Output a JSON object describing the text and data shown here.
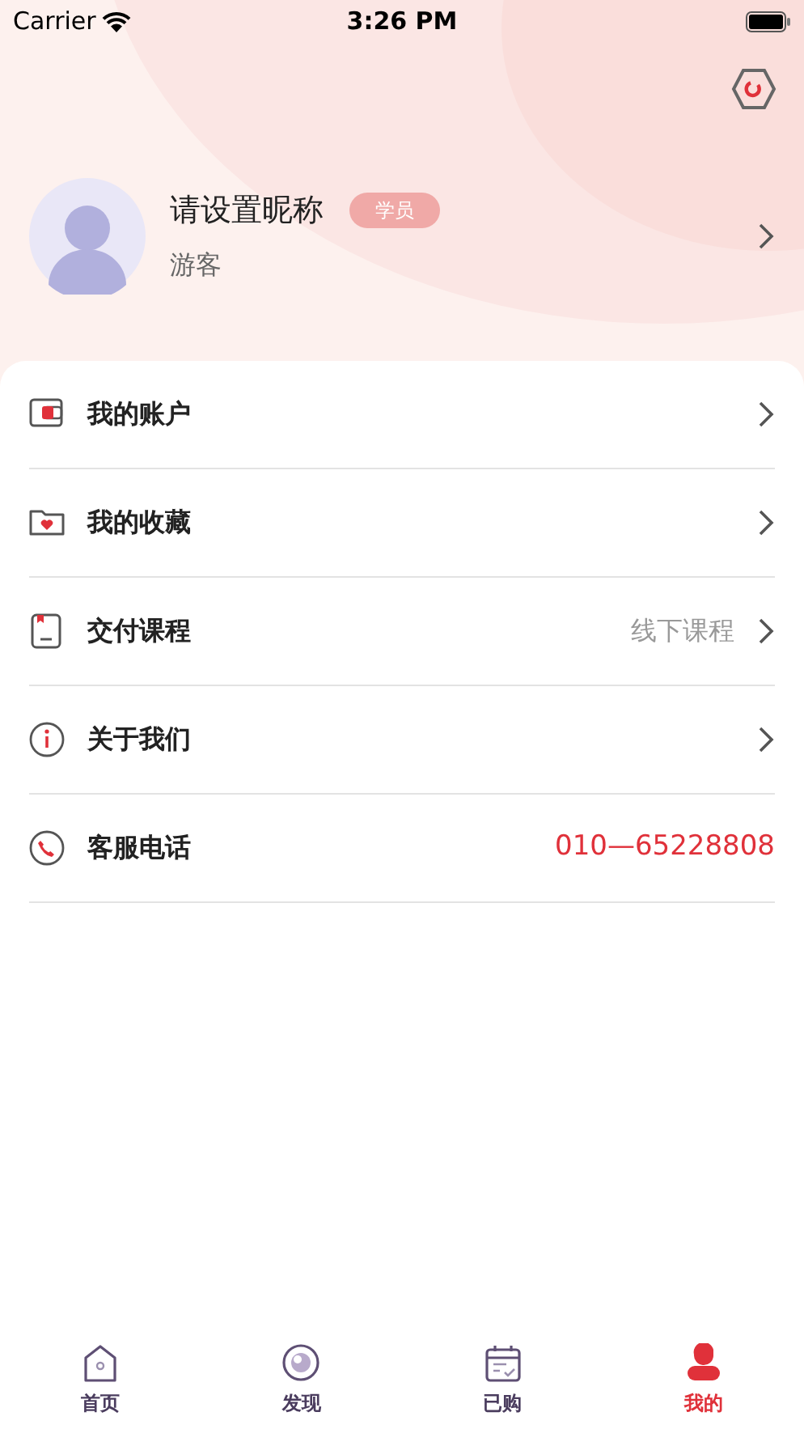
{
  "status_bar": {
    "carrier": "Carrier",
    "time": "3:26 PM"
  },
  "profile": {
    "nickname": "请设置昵称",
    "badge": "学员",
    "role": "游客"
  },
  "menu": [
    {
      "kind": "wallet",
      "label": "我的账户",
      "chevron": true
    },
    {
      "kind": "favorites",
      "label": "我的收藏",
      "chevron": true
    },
    {
      "kind": "book",
      "label": "交付课程",
      "value": "线下课程",
      "chevron": true
    },
    {
      "kind": "info",
      "label": "关于我们",
      "chevron": true
    },
    {
      "kind": "phone",
      "label": "客服电话",
      "value": "010—65228808",
      "chevron": false
    }
  ],
  "tabs": [
    {
      "kind": "home",
      "label": "首页",
      "selected": false
    },
    {
      "kind": "discover",
      "label": "发现",
      "selected": false
    },
    {
      "kind": "purchased",
      "label": "已购",
      "selected": false
    },
    {
      "kind": "mine",
      "label": "我的",
      "selected": true
    }
  ]
}
